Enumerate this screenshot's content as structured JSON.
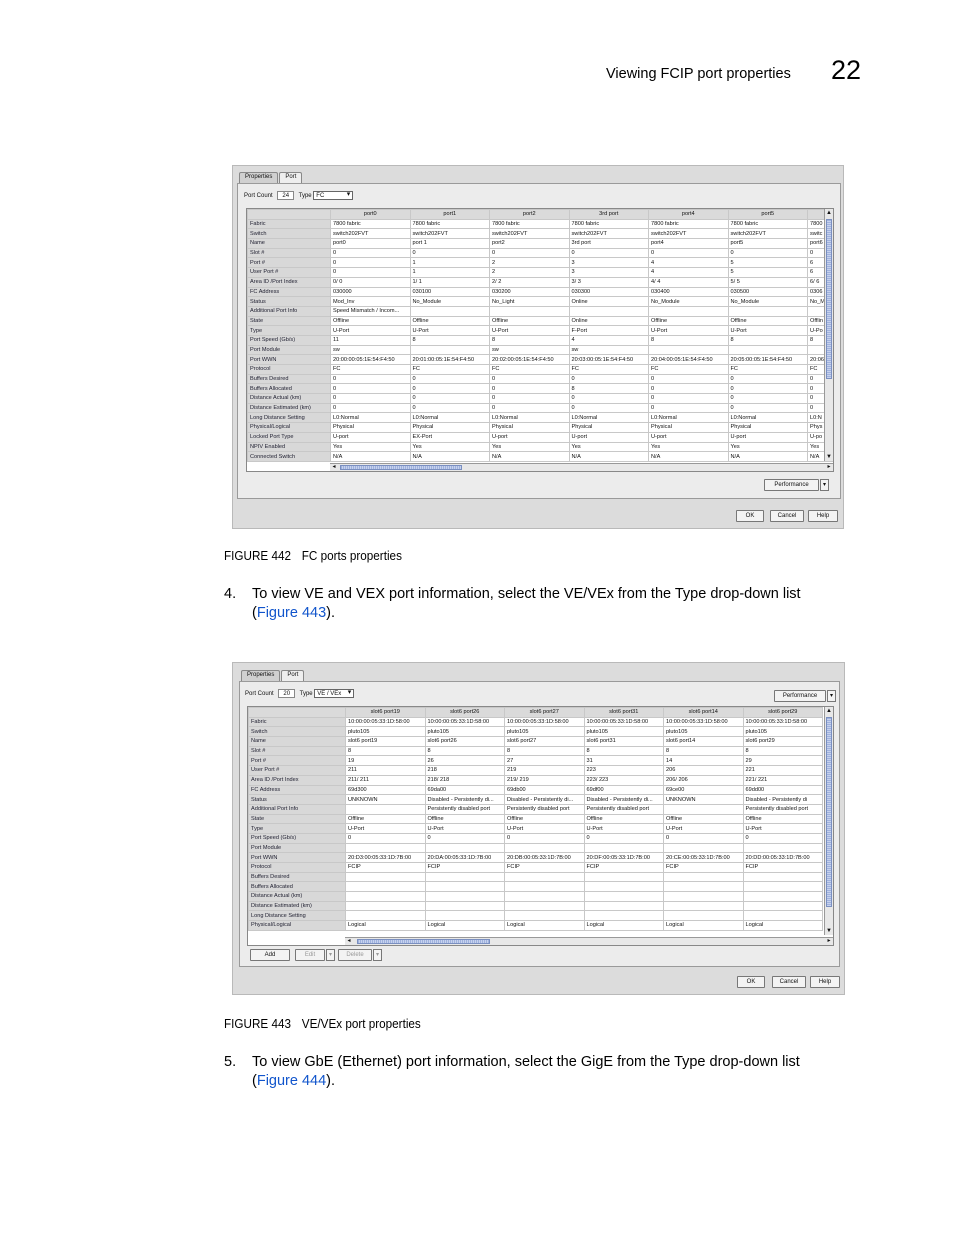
{
  "header": {
    "section_title": "Viewing FCIP port properties",
    "chapter_number": "22"
  },
  "fig442": {
    "caption_num": "FIGURE 442",
    "caption_text": "FC ports properties",
    "tabs": [
      "Properties",
      "Port"
    ],
    "port_count_label": "Port Count",
    "port_count": "24",
    "type_label": "Type",
    "type_value": "FC",
    "columns": [
      "port0",
      "port1",
      "port2",
      "3rd port",
      "port4",
      "port5",
      "port6"
    ],
    "rows": [
      {
        "label": "Fabric",
        "cells": [
          "7800 fabric",
          "7800 fabric",
          "7800 fabric",
          "7800 fabric",
          "7800 fabric",
          "7800 fabric",
          "7800"
        ]
      },
      {
        "label": "Switch",
        "cells": [
          "switch202FVT",
          "switch202FVT",
          "switch202FVT",
          "switch202FVT",
          "switch202FVT",
          "switch202FVT",
          "switc"
        ]
      },
      {
        "label": "Name",
        "cells": [
          "port0",
          "port 1",
          "port2",
          "3rd port",
          "port4",
          "port5",
          "port6"
        ]
      },
      {
        "label": "Slot #",
        "cells": [
          "0",
          "0",
          "0",
          "0",
          "0",
          "0",
          "0"
        ]
      },
      {
        "label": "Port #",
        "cells": [
          "0",
          "1",
          "2",
          "3",
          "4",
          "5",
          "6"
        ]
      },
      {
        "label": "User Port #",
        "cells": [
          "0",
          "1",
          "2",
          "3",
          "4",
          "5",
          "6"
        ]
      },
      {
        "label": "Area ID /Port Index",
        "cells": [
          "0/ 0",
          "1/ 1",
          "2/ 2",
          "3/ 3",
          "4/ 4",
          "5/ 5",
          "6/ 6"
        ]
      },
      {
        "label": "FC Address",
        "cells": [
          "030000",
          "030100",
          "030200",
          "030300",
          "030400",
          "030500",
          "0306"
        ]
      },
      {
        "label": "Status",
        "cells": [
          "Mod_Inv",
          "No_Module",
          "No_Light",
          "Online",
          "No_Module",
          "No_Module",
          "No_M"
        ]
      },
      {
        "label": "Additional Port Info",
        "cells": [
          "Speed Mismatch / Incom...",
          "",
          "",
          "",
          "",
          "",
          ""
        ]
      },
      {
        "label": "State",
        "cells": [
          "Offline",
          "Offline",
          "Offline",
          "Online",
          "Offline",
          "Offline",
          "Offlin"
        ]
      },
      {
        "label": "Type",
        "cells": [
          "U-Port",
          "U-Port",
          "U-Port",
          "F-Port",
          "U-Port",
          "U-Port",
          "U-Po"
        ]
      },
      {
        "label": "Port Speed (Gb/s)",
        "cells": [
          "11",
          "8",
          "8",
          "4",
          "8",
          "8",
          "8"
        ]
      },
      {
        "label": "Port Module",
        "cells": [
          "sw",
          "",
          "sw",
          "sw",
          "",
          "",
          ""
        ]
      },
      {
        "label": "Port WWN",
        "cells": [
          "20:00:00:05:1E:54:F4:50",
          "20:01:00:05:1E:54:F4:50",
          "20:02:00:05:1E:54:F4:50",
          "20:03:00:05:1E:54:F4:50",
          "20:04:00:05:1E:54:F4:50",
          "20:05:00:05:1E:54:F4:50",
          "20:06"
        ]
      },
      {
        "label": "Protocol",
        "cells": [
          "FC",
          "FC",
          "FC",
          "FC",
          "FC",
          "FC",
          "FC"
        ]
      },
      {
        "label": "Buffers Desired",
        "cells": [
          "0",
          "0",
          "0",
          "0",
          "0",
          "0",
          "0"
        ]
      },
      {
        "label": "Buffers Allocated",
        "cells": [
          "0",
          "0",
          "0",
          "8",
          "0",
          "0",
          "0"
        ]
      },
      {
        "label": "Distance Actual (km)",
        "cells": [
          "0",
          "0",
          "0",
          "0",
          "0",
          "0",
          "0"
        ]
      },
      {
        "label": "Distance Estimated (km)",
        "cells": [
          "0",
          "0",
          "0",
          "0",
          "0",
          "0",
          "0"
        ]
      },
      {
        "label": "Long Distance Setting",
        "cells": [
          "L0:Normal",
          "L0:Normal",
          "L0:Normal",
          "L0:Normal",
          "L0:Normal",
          "L0:Normal",
          "L0:N"
        ]
      },
      {
        "label": "Physical/Logical",
        "cells": [
          "Physical",
          "Physical",
          "Physical",
          "Physical",
          "Physical",
          "Physical",
          "Phys"
        ]
      },
      {
        "label": "Locked Port Type",
        "cells": [
          "U-port",
          "EX-Port",
          "U-port",
          "U-port",
          "U-port",
          "U-port",
          "U-po"
        ]
      },
      {
        "label": "NPIV Enabled",
        "cells": [
          "Yes",
          "Yes",
          "Yes",
          "Yes",
          "Yes",
          "Yes",
          "Yes"
        ]
      },
      {
        "label": "Connected Switch",
        "cells": [
          "N/A",
          "N/A",
          "N/A",
          "N/A",
          "N/A",
          "N/A",
          "N/A"
        ]
      }
    ],
    "performance_label": "Performance",
    "ok_label": "OK",
    "cancel_label": "Cancel",
    "help_label": "Help"
  },
  "step4": {
    "number": "4.",
    "text_a": "To view VE and VEX port information, select the ",
    "bold_a": "VE/VEx",
    "text_b": " from the ",
    "bold_b": "Type",
    "text_c": " drop-down list",
    "open": "(",
    "link": "Figure 443",
    "close": ")."
  },
  "fig443": {
    "caption_num": "FIGURE 443",
    "caption_text": "VE/VEx port properties",
    "tabs": [
      "Properties",
      "Port"
    ],
    "port_count_label": "Port Count",
    "port_count": "20",
    "type_label": "Type",
    "type_value": "VE / VEx",
    "columns": [
      "slot6 port19",
      "slot6 port26",
      "slot6 port27",
      "slot6 port31",
      "slot6 port14",
      "slot6 port29"
    ],
    "rows": [
      {
        "label": "Fabric",
        "cells": [
          "10:00:00:05:33:1D:58:00",
          "10:00:00:05:33:1D:58:00",
          "10:00:00:05:33:1D:58:00",
          "10:00:00:05:33:1D:58:00",
          "10:00:00:05:33:1D:58:00",
          "10:00:00:05:33:1D:58:00"
        ]
      },
      {
        "label": "Switch",
        "cells": [
          "pluto105",
          "pluto105",
          "pluto105",
          "pluto105",
          "pluto105",
          "pluto105"
        ]
      },
      {
        "label": "Name",
        "cells": [
          "slot6 port19",
          "slot6 port26",
          "slot6 port27",
          "slot6 port31",
          "slot6 port14",
          "slot6 port29"
        ]
      },
      {
        "label": "Slot #",
        "cells": [
          "8",
          "8",
          "8",
          "8",
          "8",
          "8"
        ]
      },
      {
        "label": "Port #",
        "cells": [
          "19",
          "26",
          "27",
          "31",
          "14",
          "29"
        ]
      },
      {
        "label": "User Port #",
        "cells": [
          "211",
          "218",
          "219",
          "223",
          "206",
          "221"
        ]
      },
      {
        "label": "Area ID /Port Index",
        "cells": [
          "211/ 211",
          "218/ 218",
          "219/ 219",
          "223/ 223",
          "206/ 206",
          "221/ 221"
        ]
      },
      {
        "label": "FC Address",
        "cells": [
          "69d300",
          "69da00",
          "69db00",
          "69df00",
          "69ce00",
          "69dd00"
        ]
      },
      {
        "label": "Status",
        "cells": [
          "UNKNOWN",
          "Disabled - Persistently di...",
          "Disabled - Persistently di...",
          "Disabled - Persistently di...",
          "UNKNOWN",
          "Disabled - Persistently di"
        ]
      },
      {
        "label": "Additional Port Info",
        "cells": [
          "",
          "Persistently disabled port",
          "Persistently disabled port",
          "Persistently disabled port",
          "",
          "Persistently disabled port"
        ]
      },
      {
        "label": "State",
        "cells": [
          "Offline",
          "Offline",
          "Offline",
          "Offline",
          "Offline",
          "Offline"
        ]
      },
      {
        "label": "Type",
        "cells": [
          "U-Port",
          "U-Port",
          "U-Port",
          "U-Port",
          "U-Port",
          "U-Port"
        ]
      },
      {
        "label": "Port Speed (Gb/s)",
        "cells": [
          "0",
          "0",
          "0",
          "0",
          "0",
          "0"
        ]
      },
      {
        "label": "Port Module",
        "cells": [
          "",
          "",
          "",
          "",
          "",
          ""
        ]
      },
      {
        "label": "Port WWN",
        "cells": [
          "20:D3:00:05:33:1D:7B:00",
          "20:DA:00:05:33:1D:7B:00",
          "20:DB:00:05:33:1D:7B:00",
          "20:DF:00:05:33:1D:7B:00",
          "20:CE:00:05:33:1D:7B:00",
          "20:DD:00:05:33:1D:7B:00"
        ]
      },
      {
        "label": "Protocol",
        "cells": [
          "FCIP",
          "FCIP",
          "FCIP",
          "FCIP",
          "FCIP",
          "FCIP"
        ]
      },
      {
        "label": "Buffers Desired",
        "cells": [
          "",
          "",
          "",
          "",
          "",
          ""
        ]
      },
      {
        "label": "Buffers Allocated",
        "cells": [
          "",
          "",
          "",
          "",
          "",
          ""
        ]
      },
      {
        "label": "Distance Actual (km)",
        "cells": [
          "",
          "",
          "",
          "",
          "",
          ""
        ]
      },
      {
        "label": "Distance Estimated (km)",
        "cells": [
          "",
          "",
          "",
          "",
          "",
          ""
        ]
      },
      {
        "label": "Long Distance Setting",
        "cells": [
          "",
          "",
          "",
          "",
          "",
          ""
        ]
      },
      {
        "label": "Physical/Logical",
        "cells": [
          "Logical",
          "Logical",
          "Logical",
          "Logical",
          "Logical",
          "Logical"
        ]
      }
    ],
    "performance_label": "Performance",
    "add_label": "Add",
    "edit_label": "Edit",
    "delete_label": "Delete",
    "ok_label": "OK",
    "cancel_label": "Cancel",
    "help_label": "Help"
  },
  "step5": {
    "number": "5.",
    "text_a": "To view GbE (Ethernet) port information, select the ",
    "bold_a": "GigE",
    "text_b": " from the ",
    "bold_b": "Type",
    "text_c": " drop-down list",
    "open": "(",
    "link": "Figure 444",
    "close": ")."
  }
}
